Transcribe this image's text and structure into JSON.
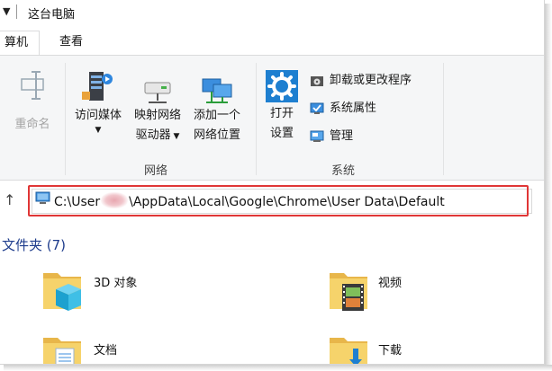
{
  "window": {
    "title": "这台电脑"
  },
  "tabs": [
    {
      "label": "算机",
      "active": true
    },
    {
      "label": "查看",
      "active": false
    }
  ],
  "ribbon": {
    "location_group": {
      "rename": "重命名"
    },
    "network_group": {
      "label": "网络",
      "access_media": "访问媒体",
      "map_drive_line1": "映射网络",
      "map_drive_line2": "驱动器",
      "add_location_line1": "添加一个",
      "add_location_line2": "网络位置"
    },
    "system_group": {
      "label": "系统",
      "open_settings_line1": "打开",
      "open_settings_line2": "设置",
      "uninstall": "卸载或更改程序",
      "system_properties": "系统属性",
      "manage": "管理"
    }
  },
  "address": {
    "path_prefix": "C:\\User",
    "path_suffix": "\\AppData\\Local\\Google\\Chrome\\User Data\\Default"
  },
  "content": {
    "section_title": "文件夹 (7)",
    "folders": [
      {
        "name": "3D 对象",
        "icon": "3d-objects-folder-icon"
      },
      {
        "name": "视频",
        "icon": "videos-folder-icon"
      },
      {
        "name": "文档",
        "icon": "documents-folder-icon"
      },
      {
        "name": "下载",
        "icon": "downloads-folder-icon"
      }
    ]
  },
  "colors": {
    "highlight": "#e03636",
    "section_title": "#1e3c8c",
    "accent": "#1e7fd0"
  }
}
